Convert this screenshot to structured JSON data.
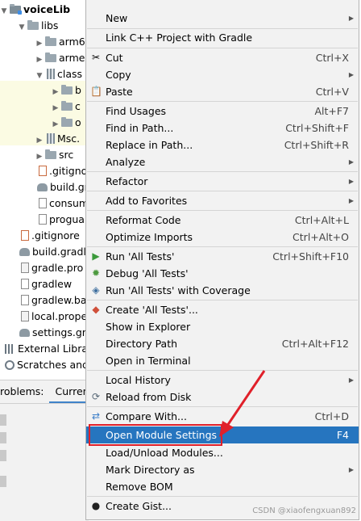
{
  "project_tree": {
    "root": "voiceLib",
    "items": [
      {
        "label": "libs"
      },
      {
        "label": "arm6"
      },
      {
        "label": "arme"
      },
      {
        "label": "class"
      },
      {
        "label": "b"
      },
      {
        "label": "c"
      },
      {
        "label": "o"
      },
      {
        "label": "Msc."
      },
      {
        "label": "src"
      },
      {
        "label": ".gitigno"
      },
      {
        "label": "build.gr"
      },
      {
        "label": "consum"
      },
      {
        "label": "progua"
      },
      {
        "label": ".gitignore"
      },
      {
        "label": "build.gradl"
      },
      {
        "label": "gradle.pro"
      },
      {
        "label": "gradlew"
      },
      {
        "label": "gradlew.ba"
      },
      {
        "label": "local.prope"
      },
      {
        "label": "settings.gr"
      },
      {
        "label": "External Libra"
      },
      {
        "label": "Scratches and"
      }
    ]
  },
  "bottom_panel": {
    "tab1": "roblems:",
    "tab2": "Curren"
  },
  "context_menu": {
    "items": {
      "new": {
        "label": "New"
      },
      "link_cpp": {
        "label": "Link C++ Project with Gradle"
      },
      "cut": {
        "label": "Cut",
        "shortcut": "Ctrl+X"
      },
      "copy": {
        "label": "Copy"
      },
      "paste": {
        "label": "Paste",
        "shortcut": "Ctrl+V"
      },
      "find_usages": {
        "label": "Find Usages",
        "shortcut": "Alt+F7"
      },
      "find_in_path": {
        "label": "Find in Path...",
        "shortcut": "Ctrl+Shift+F"
      },
      "replace_in_path": {
        "label": "Replace in Path...",
        "shortcut": "Ctrl+Shift+R"
      },
      "analyze": {
        "label": "Analyze"
      },
      "refactor": {
        "label": "Refactor"
      },
      "add_to_favorites": {
        "label": "Add to Favorites"
      },
      "reformat_code": {
        "label": "Reformat Code",
        "shortcut": "Ctrl+Alt+L"
      },
      "optimize_imports": {
        "label": "Optimize Imports",
        "shortcut": "Ctrl+Alt+O"
      },
      "run_tests": {
        "label": "Run 'All Tests'",
        "shortcut": "Ctrl+Shift+F10"
      },
      "debug_tests": {
        "label": "Debug 'All Tests'"
      },
      "coverage_tests": {
        "label": "Run 'All Tests' with Coverage"
      },
      "create_tests": {
        "label": "Create 'All Tests'..."
      },
      "show_in_explorer": {
        "label": "Show in Explorer"
      },
      "directory_path": {
        "label": "Directory Path",
        "shortcut": "Ctrl+Alt+F12"
      },
      "open_in_terminal": {
        "label": "Open in Terminal"
      },
      "local_history": {
        "label": "Local History"
      },
      "reload_from_disk": {
        "label": "Reload from Disk"
      },
      "compare_with": {
        "label": "Compare With...",
        "shortcut": "Ctrl+D"
      },
      "open_module_settings": {
        "label": "Open Module Settings",
        "shortcut": "F4"
      },
      "load_unload_modules": {
        "label": "Load/Unload Modules..."
      },
      "mark_directory_as": {
        "label": "Mark Directory as"
      },
      "remove_bom": {
        "label": "Remove BOM"
      },
      "create_gist": {
        "label": "Create Gist..."
      }
    }
  },
  "watermark": "CSDN @xiaofengxuan892",
  "colors": {
    "selection": "#2675bf",
    "annotation_red": "#e0202a",
    "menu_bg": "#f2f2f2",
    "tree_highlight": "#fbfbe3"
  }
}
